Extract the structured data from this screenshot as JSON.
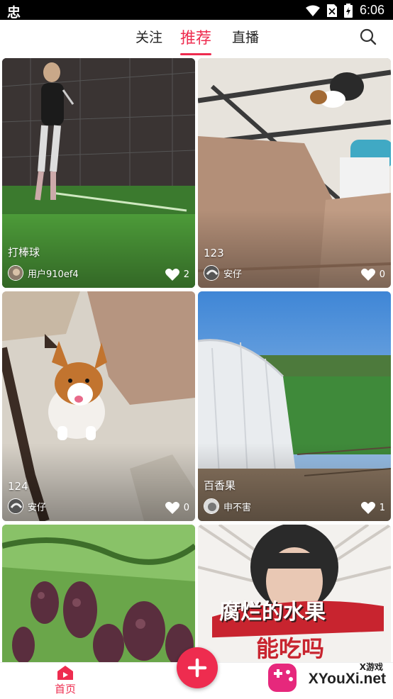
{
  "status_bar": {
    "time": "6:06",
    "icons": [
      "app-glyph-icon",
      "wifi-icon",
      "no-sim-icon",
      "battery-icon"
    ]
  },
  "top_nav": {
    "tabs": [
      {
        "label": "关注",
        "active": false
      },
      {
        "label": "推荐",
        "active": true
      },
      {
        "label": "直播",
        "active": false
      }
    ],
    "search_icon": "search-icon"
  },
  "feed": {
    "cards": [
      {
        "title": "打棒球",
        "author": "用户910ef4",
        "likes": "2"
      },
      {
        "title": "123",
        "author": "安仔",
        "likes": "0"
      },
      {
        "title": "124",
        "author": "安仔",
        "likes": "0"
      },
      {
        "title": "百香果",
        "author": "申不害",
        "likes": "1"
      },
      {
        "title": "",
        "author": "",
        "likes": ""
      },
      {
        "title": "",
        "author": "",
        "likes": ""
      }
    ],
    "card6_overlay": {
      "line1": "腐烂的水果",
      "line2": "能吃吗"
    }
  },
  "bottom_bar": {
    "home_label": "首页",
    "add_button": "plus-icon"
  },
  "watermark": {
    "small": "X游戏",
    "text": "XYouXi.net"
  },
  "colors": {
    "accent": "#ee2c4f"
  }
}
